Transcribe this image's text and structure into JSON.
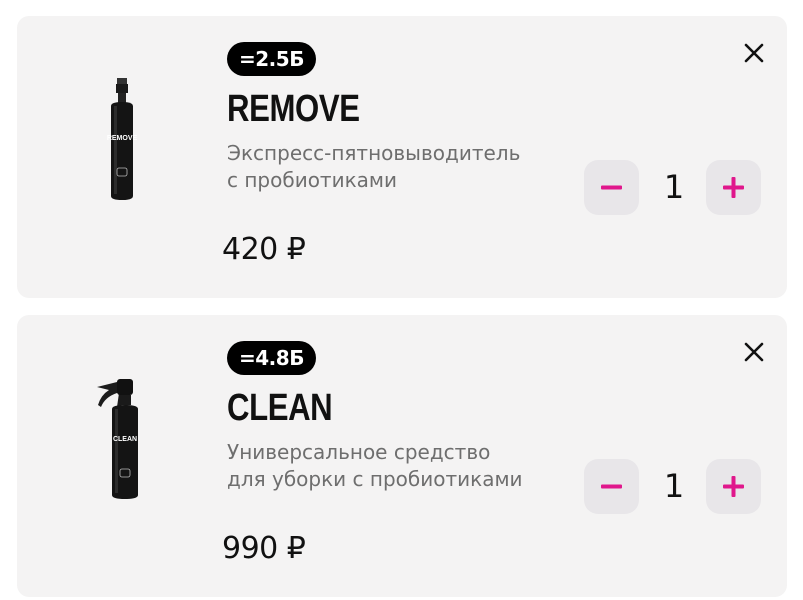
{
  "accent_color": "#e0178c",
  "cart": {
    "items": [
      {
        "badge": "=2.5Б",
        "title": "REMOVE",
        "description": "Экспресс-пятновыводитель с пробиотиками",
        "price": "420 ₽",
        "quantity": "1",
        "bottle_label": "REMOVE",
        "remove_icon": "close-icon",
        "decrement_icon": "minus-icon",
        "increment_icon": "plus-icon"
      },
      {
        "badge": "=4.8Б",
        "title": "CLEAN",
        "description": "Универсальное средство для уборки с пробиотиками",
        "price": "990 ₽",
        "quantity": "1",
        "bottle_label": "CLEAN",
        "remove_icon": "close-icon",
        "decrement_icon": "minus-icon",
        "increment_icon": "plus-icon"
      }
    ]
  }
}
